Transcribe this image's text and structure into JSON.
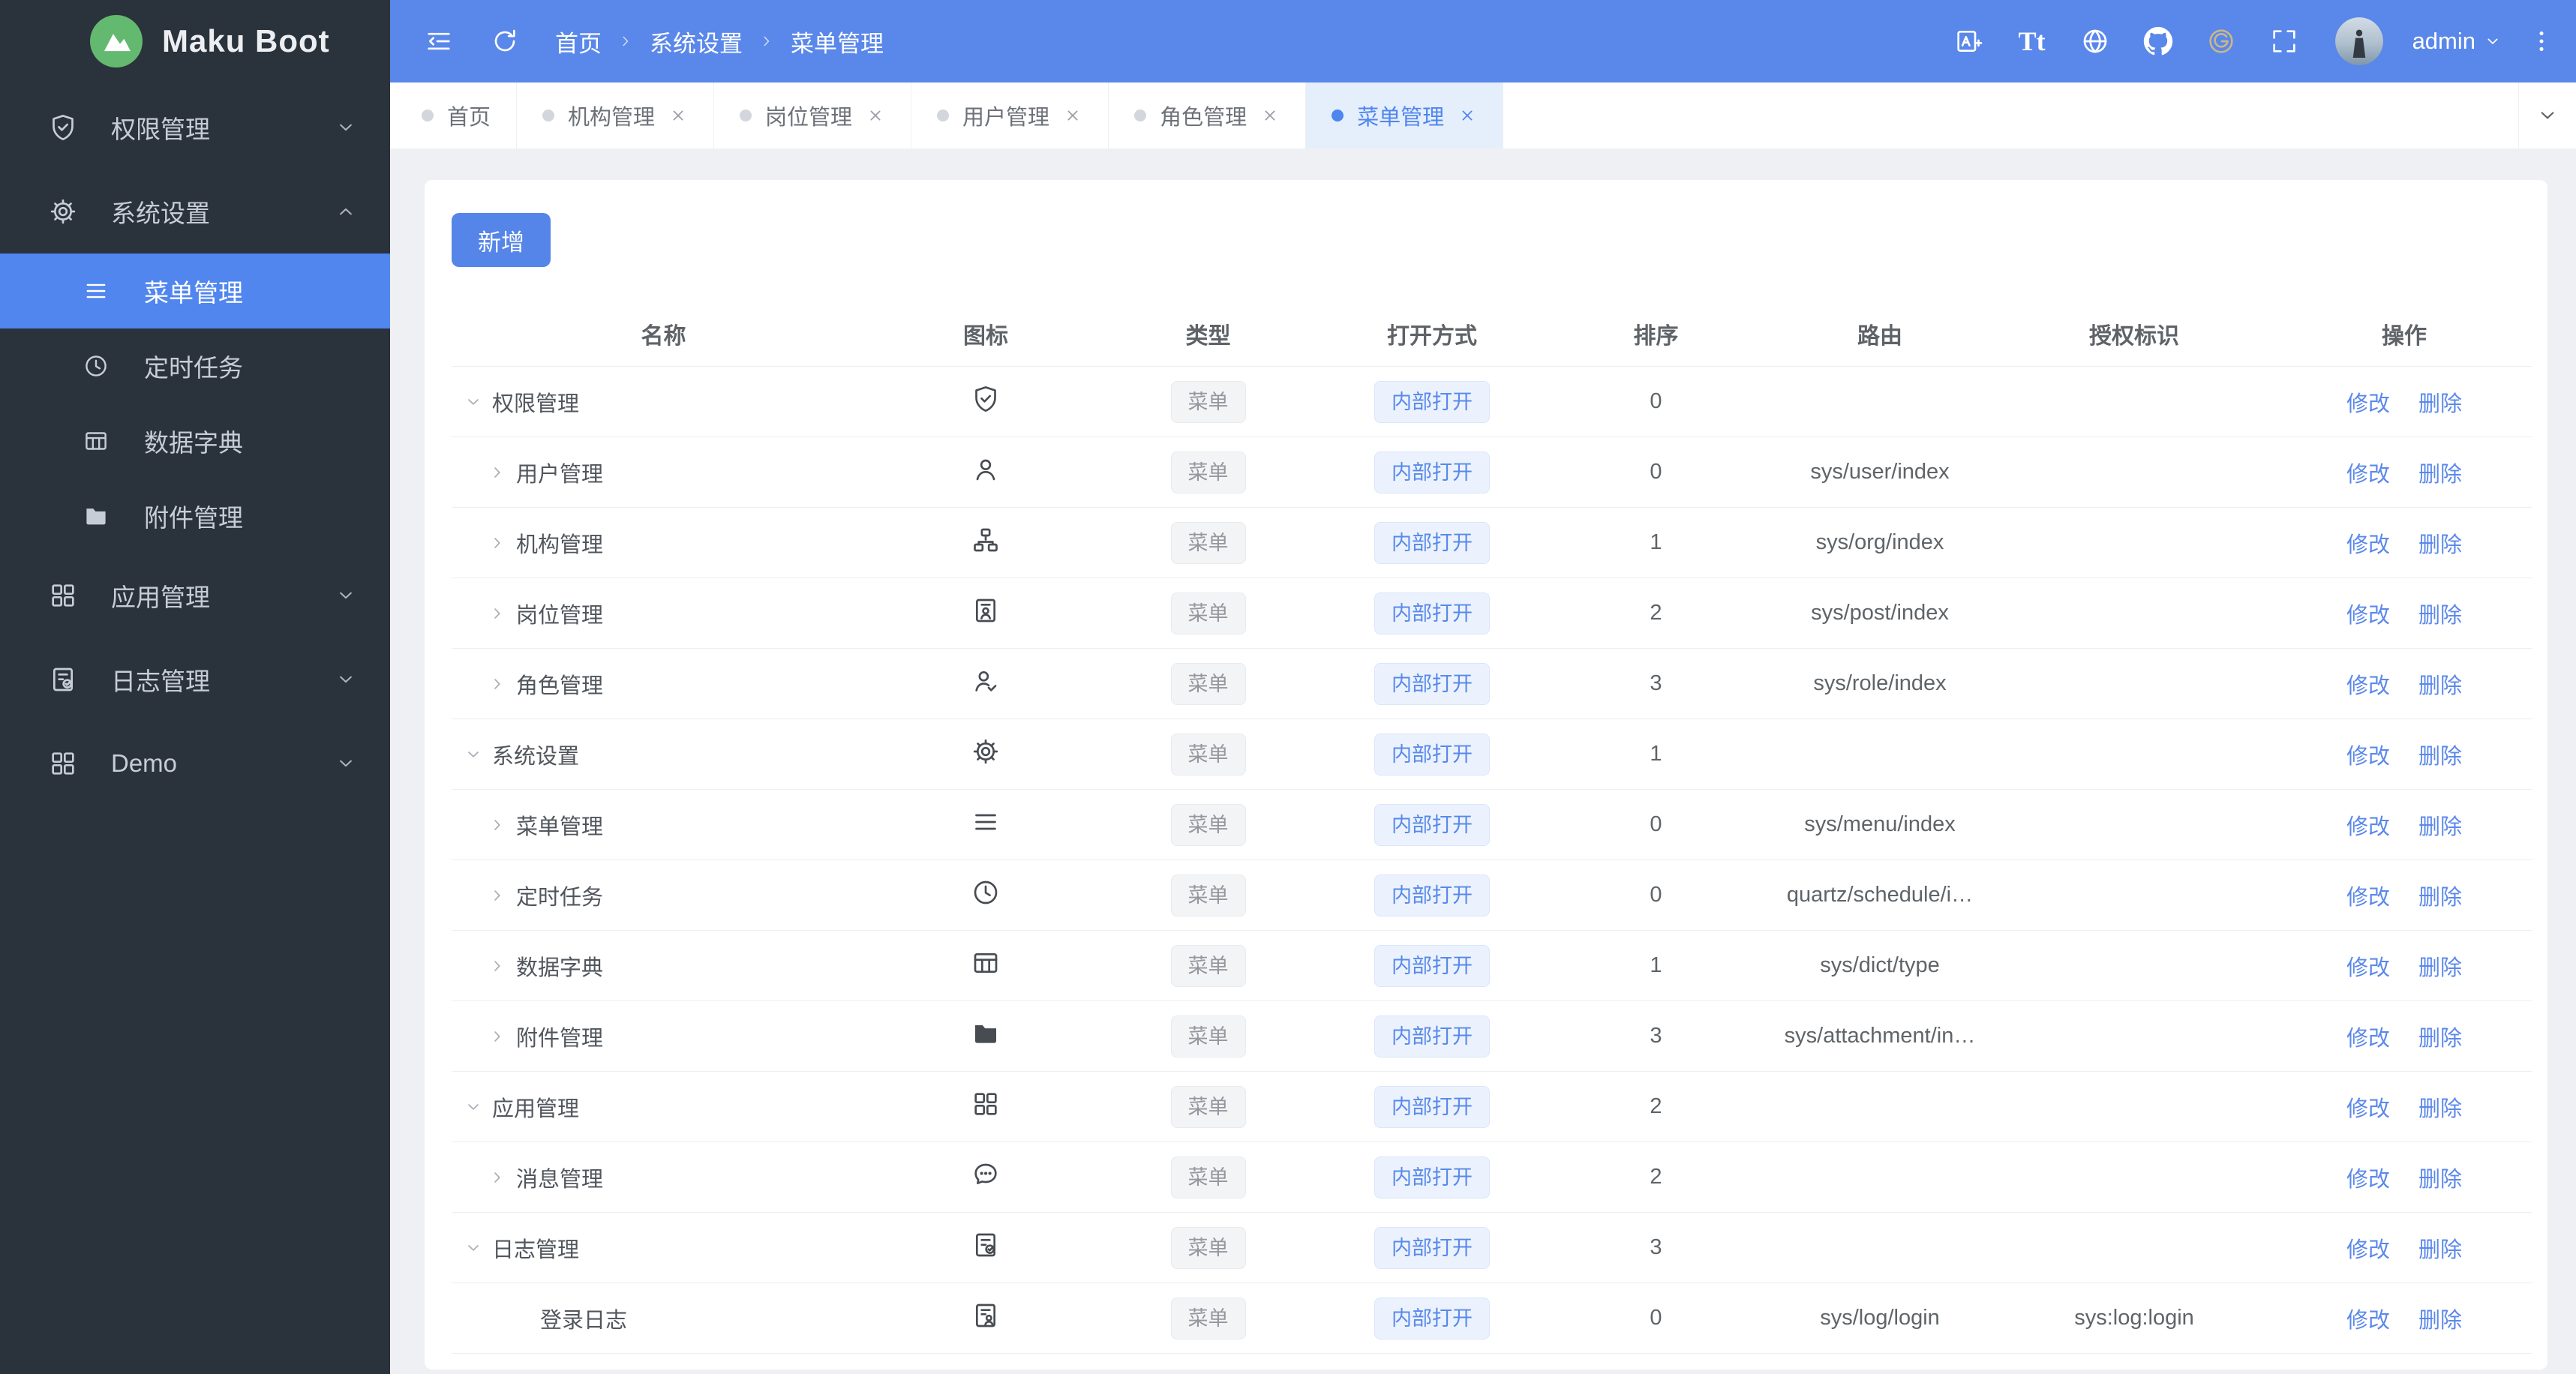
{
  "app": {
    "logo_text": "Maku Boot",
    "accent_color": "#5a87ea",
    "sidebar_color": "#2a323c"
  },
  "sidebar": {
    "items": [
      {
        "label": "权限管理",
        "icon": "shield-check-icon",
        "chevron": "chevron-down-icon"
      },
      {
        "label": "系统设置",
        "icon": "gear-icon",
        "chevron": "chevron-up-icon",
        "children": [
          {
            "label": "菜单管理",
            "icon": "menu-icon",
            "active": true
          },
          {
            "label": "定时任务",
            "icon": "clock-icon"
          },
          {
            "label": "数据字典",
            "icon": "table-icon"
          },
          {
            "label": "附件管理",
            "icon": "folder-icon"
          }
        ]
      },
      {
        "label": "应用管理",
        "icon": "grid-icon",
        "chevron": "chevron-down-icon"
      },
      {
        "label": "日志管理",
        "icon": "log-icon",
        "chevron": "chevron-down-icon"
      },
      {
        "label": "Demo",
        "icon": "grid-icon",
        "chevron": "chevron-down-icon"
      }
    ]
  },
  "header": {
    "breadcrumb": [
      "首页",
      "系统设置",
      "菜单管理"
    ],
    "font_size_label": "Tt",
    "icons": [
      "translate-icon",
      "font-size-icon",
      "globe-icon",
      "github-icon",
      "gitee-icon",
      "fullscreen-icon"
    ],
    "user": "admin"
  },
  "tabs": [
    {
      "label": "首页",
      "closable": false,
      "active": false
    },
    {
      "label": "机构管理",
      "closable": true,
      "active": false
    },
    {
      "label": "岗位管理",
      "closable": true,
      "active": false
    },
    {
      "label": "用户管理",
      "closable": true,
      "active": false
    },
    {
      "label": "角色管理",
      "closable": true,
      "active": false
    },
    {
      "label": "菜单管理",
      "closable": true,
      "active": true
    }
  ],
  "toolbar": {
    "add_label": "新增"
  },
  "table": {
    "columns": [
      "名称",
      "图标",
      "类型",
      "打开方式",
      "排序",
      "路由",
      "授权标识",
      "操作"
    ],
    "type_tag": "菜单",
    "open_tag": "内部打开",
    "edit_label": "修改",
    "delete_label": "删除",
    "rows": [
      {
        "name": "权限管理",
        "level": 1,
        "chevron": "down",
        "icon": "shield-check-icon",
        "sort": "0",
        "route": "",
        "auth": ""
      },
      {
        "name": "用户管理",
        "level": 2,
        "chevron": "right",
        "icon": "user-icon",
        "sort": "0",
        "route": "sys/user/index",
        "auth": ""
      },
      {
        "name": "机构管理",
        "level": 2,
        "chevron": "right",
        "icon": "org-icon",
        "sort": "1",
        "route": "sys/org/index",
        "auth": ""
      },
      {
        "name": "岗位管理",
        "level": 2,
        "chevron": "right",
        "icon": "post-icon",
        "sort": "2",
        "route": "sys/post/index",
        "auth": ""
      },
      {
        "name": "角色管理",
        "level": 2,
        "chevron": "right",
        "icon": "role-icon",
        "sort": "3",
        "route": "sys/role/index",
        "auth": ""
      },
      {
        "name": "系统设置",
        "level": 1,
        "chevron": "down",
        "icon": "gear-icon",
        "sort": "1",
        "route": "",
        "auth": ""
      },
      {
        "name": "菜单管理",
        "level": 2,
        "chevron": "right",
        "icon": "menu-icon",
        "sort": "0",
        "route": "sys/menu/index",
        "auth": ""
      },
      {
        "name": "定时任务",
        "level": 2,
        "chevron": "right",
        "icon": "clock-icon",
        "sort": "0",
        "route": "quartz/schedule/i…",
        "auth": ""
      },
      {
        "name": "数据字典",
        "level": 2,
        "chevron": "right",
        "icon": "table-icon",
        "sort": "1",
        "route": "sys/dict/type",
        "auth": ""
      },
      {
        "name": "附件管理",
        "level": 2,
        "chevron": "right",
        "icon": "folder-icon",
        "sort": "3",
        "route": "sys/attachment/in…",
        "auth": ""
      },
      {
        "name": "应用管理",
        "level": 1,
        "chevron": "down",
        "icon": "grid-icon",
        "sort": "2",
        "route": "",
        "auth": ""
      },
      {
        "name": "消息管理",
        "level": 2,
        "chevron": "right",
        "icon": "message-icon",
        "sort": "2",
        "route": "",
        "auth": ""
      },
      {
        "name": "日志管理",
        "level": 1,
        "chevron": "down",
        "icon": "log-icon",
        "sort": "3",
        "route": "",
        "auth": ""
      },
      {
        "name": "登录日志",
        "level": 3,
        "chevron": "none",
        "icon": "doc-user-icon",
        "sort": "0",
        "route": "sys/log/login",
        "auth": "sys:log:login"
      }
    ]
  }
}
